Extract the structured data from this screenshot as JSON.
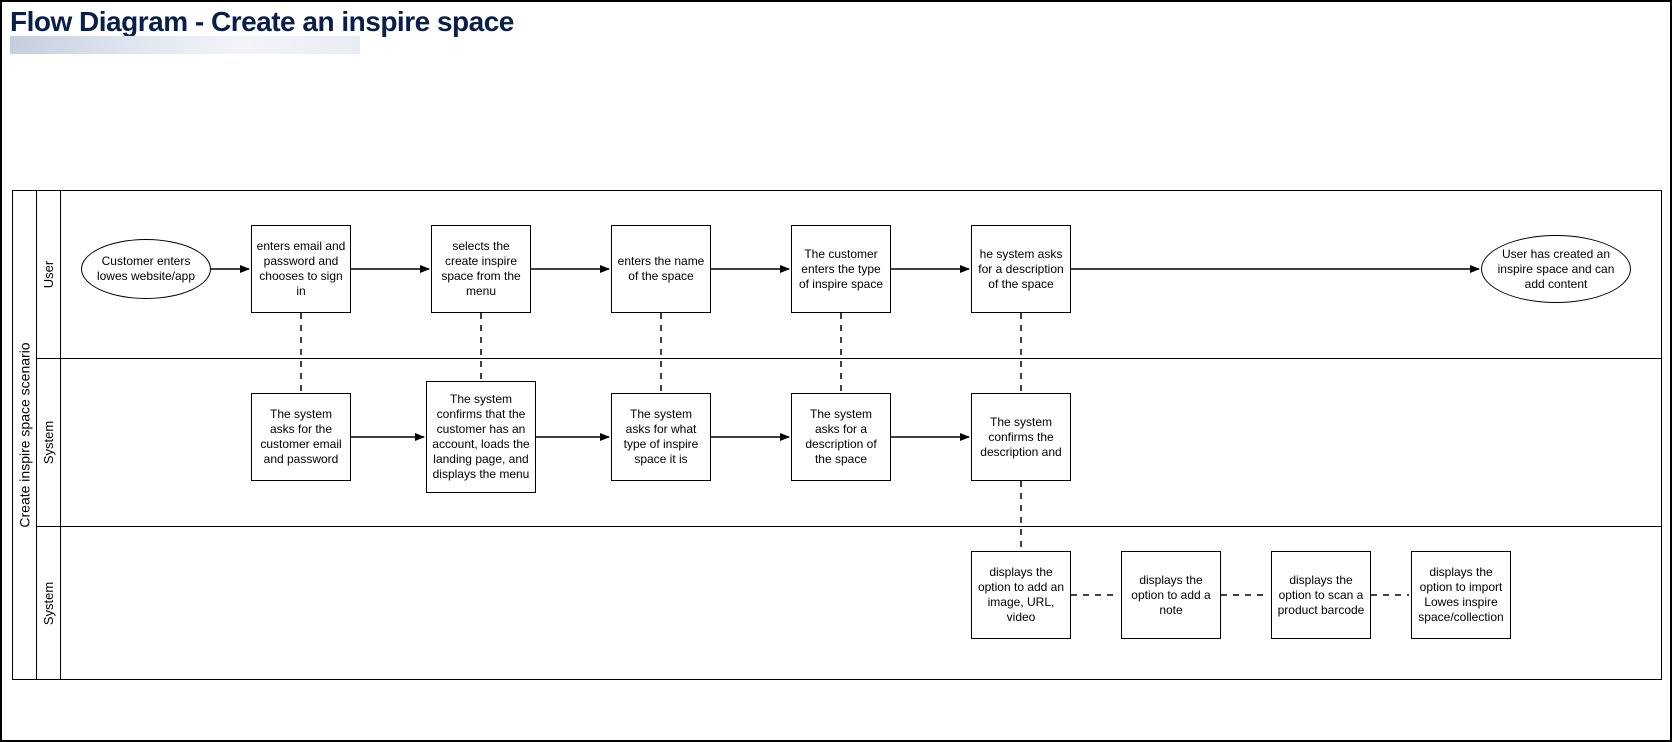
{
  "title": "Flow Diagram - Create an inspire space",
  "pool": "Create inspire space scenario",
  "lanes": {
    "user": "User",
    "system1": "System",
    "system2": "System"
  },
  "nodes": {
    "u_start": "Customer enters lowes website/app",
    "u_login": "enters email and password and chooses to sign in",
    "u_select": "selects the create inspire space from the menu",
    "u_name": "enters the name of the space",
    "u_type": "The customer enters the type of inspire space",
    "u_desc": "he system asks for a description of the space",
    "u_end": "User has created an inspire space and can add content",
    "s_ask_login": "The system asks for the customer email and password",
    "s_confirm_acct": "The system confirms that the customer has an account, loads the landing page, and displays the menu",
    "s_ask_type": "The system asks for what type of inspire space it is",
    "s_ask_desc": "The system asks for a description of the space",
    "s_confirm_desc": "The system confirms the description and",
    "opt_media": "displays the option to add an image, URL, video",
    "opt_note": "displays the option to add a note",
    "opt_barcode": "displays the option to scan a product barcode",
    "opt_import": "displays the option to import Lowes inspire space/collection"
  }
}
